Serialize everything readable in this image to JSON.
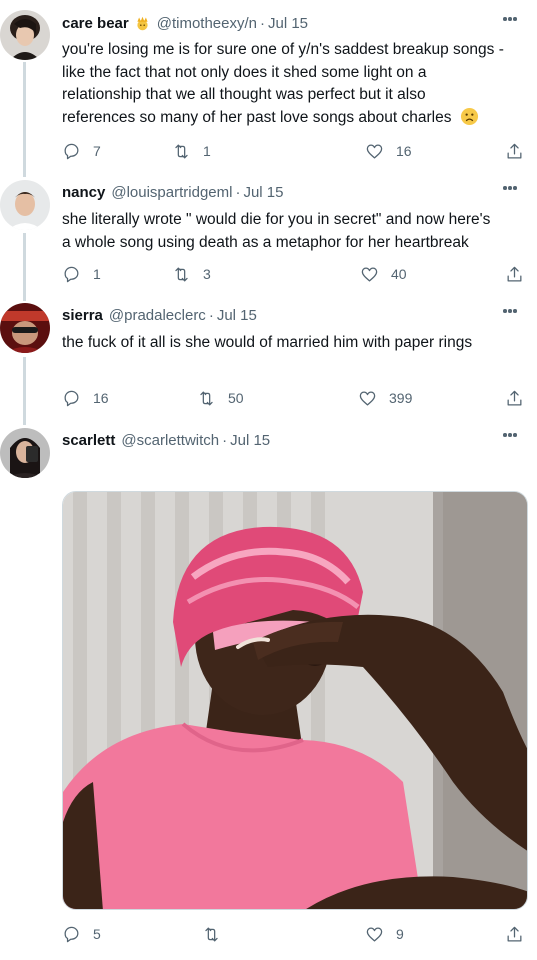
{
  "tweets": [
    {
      "name": "care bear",
      "emoji": "crown-emoji",
      "handle": "@timotheexy/n",
      "date": "Jul 15",
      "lines": [
        "you're losing me is for sure one of y/n's saddest breakup songs -",
        "like the fact that not only does it shed some light on a",
        "relationship that we all thought was perfect but it also",
        "references so many of her past love songs about charles"
      ],
      "trailing_emoji": "frowning-face-emoji",
      "replies": "7",
      "retweets": "1",
      "likes": "16"
    },
    {
      "name": "nancy",
      "handle": "@louispartridgeml",
      "date": "Jul 15",
      "lines": [
        "she literally wrote \" would die for you in secret\" and now here's",
        "a whole song using death as a metaphor for her heartbreak"
      ],
      "replies": "1",
      "retweets": "3",
      "likes": "40"
    },
    {
      "name": "sierra",
      "handle": "@pradaleclerc",
      "date": "Jul 15",
      "lines": [
        "the fuck of it all is she would of married him with paper rings"
      ],
      "replies": "16",
      "retweets": "50",
      "likes": "399"
    },
    {
      "name": "scarlett",
      "handle": "@scarlettwitch",
      "date": "Jul 15",
      "lines": [],
      "media": "reaction-photo-person-pink-shirt-hand-on-forehead",
      "replies": "5",
      "retweets": "",
      "likes": "9"
    }
  ],
  "colors": {
    "text": "#0f1419",
    "muted": "#536471",
    "thread_line": "#cfd9de",
    "background": "#ffffff"
  }
}
